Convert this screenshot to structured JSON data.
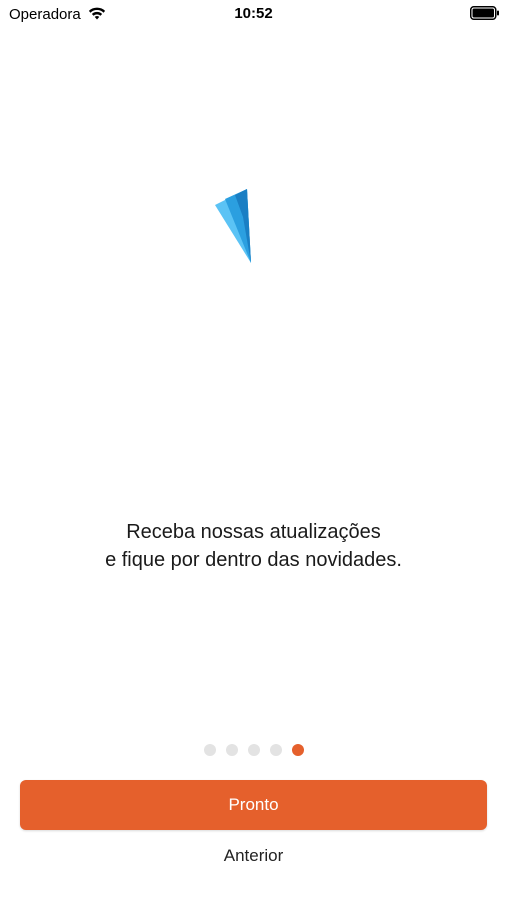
{
  "status_bar": {
    "carrier": "Operadora",
    "time": "10:52",
    "wifi_icon": "wifi-icon",
    "battery_icon": "battery-full-icon"
  },
  "illustration": {
    "icon": "paper-plane-icon",
    "colors": [
      "#5bc3f5",
      "#2b9fe0",
      "#1a7fc4"
    ]
  },
  "message": {
    "line1": "Receba nossas atualizações",
    "line2": "e fique por dentro das novidades."
  },
  "pager": {
    "total": 5,
    "current": 5
  },
  "actions": {
    "primary_label": "Pronto",
    "secondary_label": "Anterior"
  },
  "colors": {
    "accent": "#e5602c",
    "dot_inactive": "#e3e3e3",
    "background": "#ffffff"
  }
}
